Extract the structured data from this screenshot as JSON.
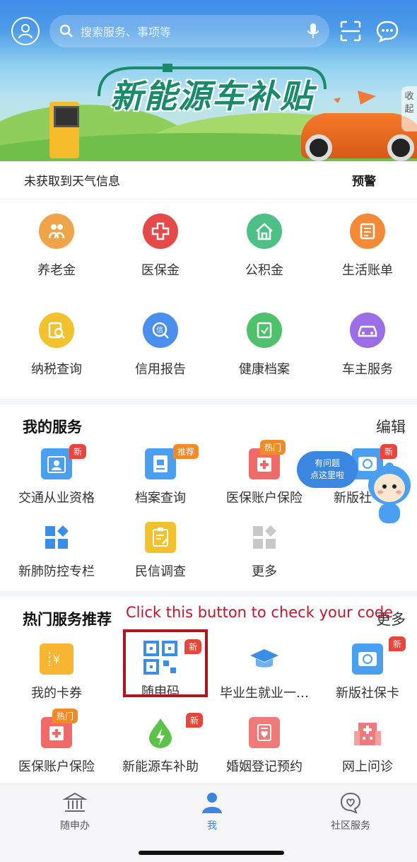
{
  "header": {
    "search_placeholder": "搜索服务、事项等"
  },
  "banner": {
    "title": "新能源车补贴",
    "collapse_label": "收起",
    "page_count": 8,
    "active_page": 3
  },
  "weather": {
    "status": "未获取到天气信息",
    "alert": "预警"
  },
  "grid": [
    {
      "label": "养老金",
      "icon": "elderly-icon",
      "color": "#f0a44a"
    },
    {
      "label": "医保金",
      "icon": "medical-cross-icon",
      "color": "#e5494a"
    },
    {
      "label": "公积金",
      "icon": "house-icon",
      "color": "#4cc087"
    },
    {
      "label": "生活账单",
      "icon": "bill-icon",
      "color": "#f58a36"
    },
    {
      "label": "纳税查询",
      "icon": "tax-search-icon",
      "color": "#f2c12e"
    },
    {
      "label": "信用报告",
      "icon": "credit-icon",
      "color": "#4a8ef0"
    },
    {
      "label": "健康档案",
      "icon": "health-file-icon",
      "color": "#4fc06c"
    },
    {
      "label": "车主服务",
      "icon": "car-icon",
      "color": "#9b6ee8"
    }
  ],
  "my_services": {
    "title": "我的服务",
    "edit": "编辑",
    "items": [
      {
        "label": "交通从业资格",
        "badge": "新",
        "icon": "id-card-icon"
      },
      {
        "label": "档案查询",
        "badge": "推荐",
        "icon": "archive-icon"
      },
      {
        "label": "医保账户保险",
        "badge": "热门",
        "icon": "medical-kit-icon"
      },
      {
        "label": "新版社",
        "badge": "新",
        "icon": "social-card-icon"
      },
      {
        "label": "新肺防控专栏",
        "badge": "",
        "icon": "blocks-icon"
      },
      {
        "label": "民信调查",
        "badge": "",
        "icon": "survey-icon"
      },
      {
        "label": "更多",
        "badge": "",
        "icon": "more-blocks-icon"
      }
    ]
  },
  "helper": {
    "line1": "有问题",
    "line2": "点这里啦"
  },
  "hot_services": {
    "title": "热门服务推荐",
    "more": "更多",
    "items": [
      {
        "label": "我的卡券",
        "badge": "",
        "icon": "coupon-icon"
      },
      {
        "label": "随申码",
        "badge": "新",
        "icon": "qr-code-icon"
      },
      {
        "label": "毕业生就业一…",
        "badge": "",
        "icon": "graduation-cap-icon"
      },
      {
        "label": "新版社保卡",
        "badge": "新",
        "icon": "social-card-icon"
      },
      {
        "label": "医保账户保险",
        "badge": "热门",
        "icon": "medical-kit-icon"
      },
      {
        "label": "新能源车补助",
        "badge": "新",
        "icon": "energy-drop-icon"
      },
      {
        "label": "婚姻登记预约",
        "badge": "",
        "icon": "marriage-icon"
      },
      {
        "label": "网上问诊",
        "badge": "",
        "icon": "hospital-icon"
      }
    ]
  },
  "annotation": {
    "text": "Click this button to check your code"
  },
  "bottom_nav": [
    {
      "label": "随申办",
      "icon": "building-icon"
    },
    {
      "label": "我",
      "icon": "person-icon"
    },
    {
      "label": "社区服务",
      "icon": "heart-chat-icon"
    }
  ]
}
